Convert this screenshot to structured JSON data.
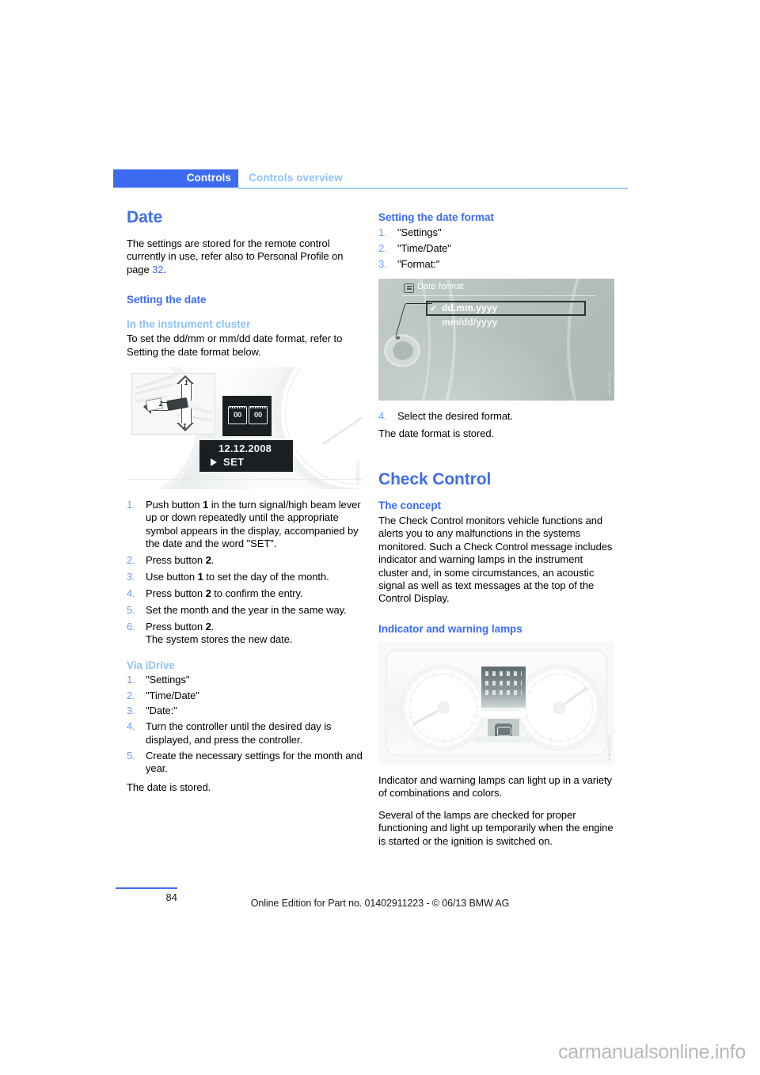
{
  "header": {
    "tab_label": "Controls",
    "section_label": "Controls overview"
  },
  "left_column": {
    "title": "Date",
    "intro": "The settings are stored for the remote control currently in use, refer also to Personal Profile on page ",
    "intro_page_ref": "32",
    "intro_end": ".",
    "heading_setting_the_date": "Setting the date",
    "subheading_cluster": "In the instrument cluster",
    "cluster_paragraph": "To set the dd/mm or mm/dd date format, refer to Setting the date format below.",
    "figure_cluster": {
      "inset_label_1_top": "1",
      "inset_label_1_bottom": "1",
      "inset_label_2": "2",
      "mini_display_left": "00",
      "mini_display_right": "00",
      "date_value": "12.12.2008",
      "set_label": "SET"
    },
    "cluster_steps": [
      {
        "num": "1.",
        "text": "Push button 1 in the turn signal/high beam lever up or down repeatedly until the appropriate symbol appears in the display, accompanied by the date and the word \"SET\"."
      },
      {
        "num": "2.",
        "text": "Press button 2."
      },
      {
        "num": "3.",
        "text": "Use button 1 to set the day of the month."
      },
      {
        "num": "4.",
        "text": "Press button 2 to confirm the entry."
      },
      {
        "num": "5.",
        "text": "Set the month and the year in the same way."
      },
      {
        "num": "6.",
        "text": "Press button 2.",
        "sub": "The system stores the new date."
      }
    ],
    "subheading_idrive": "Via iDrive",
    "idrive_steps": [
      {
        "num": "1.",
        "text": "\"Settings\""
      },
      {
        "num": "2.",
        "text": "\"Time/Date\""
      },
      {
        "num": "3.",
        "text": "\"Date:\""
      },
      {
        "num": "4.",
        "text": "Turn the controller until the desired day is displayed, and press the controller."
      },
      {
        "num": "5.",
        "text": "Create the necessary settings for the month and year."
      }
    ],
    "closing": "The date is stored."
  },
  "right_column": {
    "heading_date_format": "Setting the date format",
    "format_steps": [
      {
        "num": "1.",
        "text": "\"Settings\""
      },
      {
        "num": "2.",
        "text": "\"Time/Date\""
      },
      {
        "num": "3.",
        "text": "\"Format:\""
      }
    ],
    "figure_idrive": {
      "menu_title": "Date format",
      "option_selected": "dd.mm.yyyy",
      "option_other": "mm/dd/yyyy",
      "check_glyph": "✓"
    },
    "format_step_4": {
      "num": "4.",
      "text": "Select the desired format."
    },
    "format_stored": "The date format is stored.",
    "title_check_control": "Check Control",
    "heading_concept": "The concept",
    "concept_paragraph": "The Check Control monitors vehicle functions and alerts you to any malfunctions in the systems monitored. Such a Check Control message includes indicator and warning lamps in the instrument cluster and, in some circumstances, an acoustic signal as well as text messages at the top of the Control Display.",
    "heading_lamps": "Indicator and warning lamps",
    "lamps_paragraph_1": "Indicator and warning lamps can light up in a variety of combinations and colors.",
    "lamps_paragraph_2": "Several of the lamps are checked for proper functioning and light up temporarily when the engine is started or the ignition is switched on."
  },
  "footer": {
    "page_number": "84",
    "edition_line": "Online Edition for Part no. 01402911223 - © 06/13 BMW AG",
    "watermark": "carmanualsonline.info"
  },
  "colors": {
    "accent_blue": "#3d6cf0",
    "light_blue": "#8ec2fa",
    "rule_blue": "#9fd0fb"
  }
}
